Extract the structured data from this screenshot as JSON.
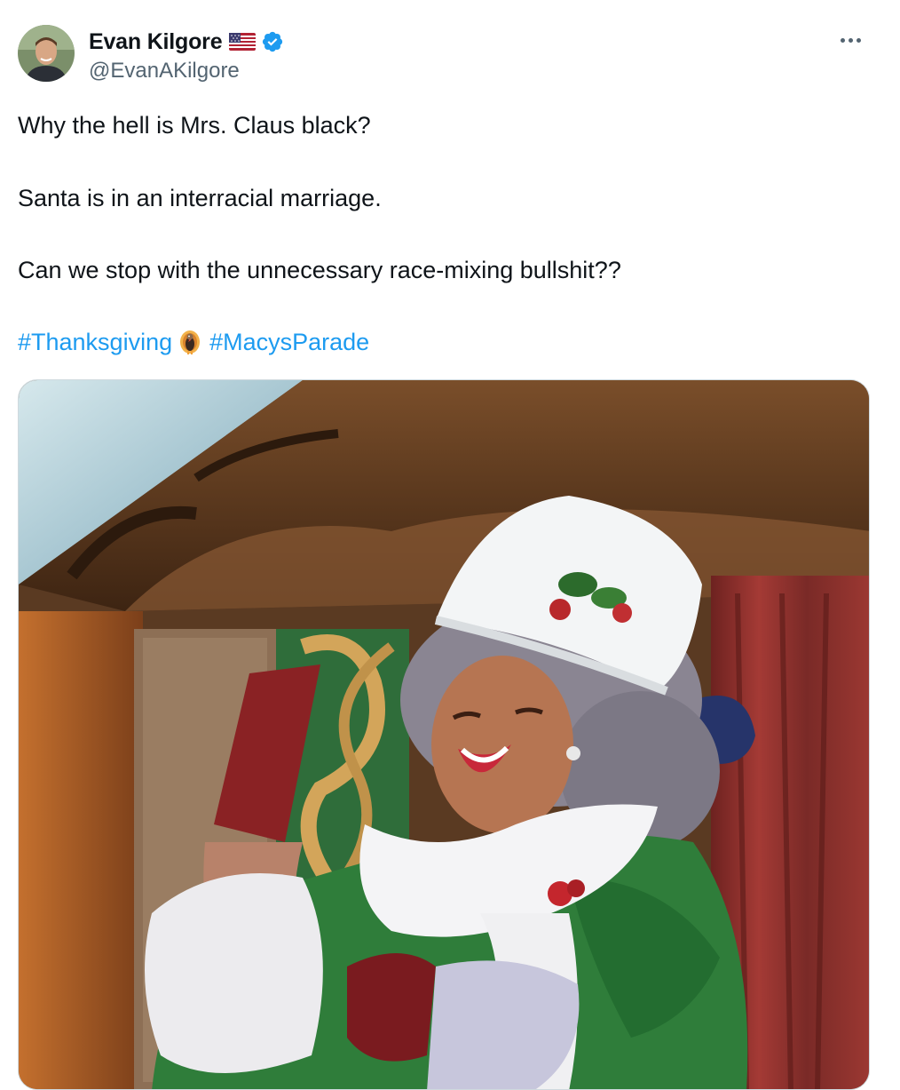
{
  "author": {
    "display_name": "Evan Kilgore",
    "handle": "@EvanAKilgore",
    "flag_icon": "us-flag-icon",
    "verified_icon": "verified-badge-icon"
  },
  "tweet": {
    "line1": "Why the hell is Mrs. Claus black?",
    "line2": "Santa is in an interracial marriage.",
    "line3": "Can we stop with the unnecessary race-mixing bullshit??",
    "hashtags": [
      "#Thanksgiving",
      "#MacysParade"
    ],
    "hashtag_separator_icon": "turkey-emoji-icon"
  },
  "menu": {
    "icon": "more-options-icon"
  },
  "media": {
    "icon": "photo-mrs-claus-parade"
  },
  "colors": {
    "link": "#1d9bf0",
    "secondary_text": "#536471",
    "verified_blue": "#1d9bf0"
  }
}
